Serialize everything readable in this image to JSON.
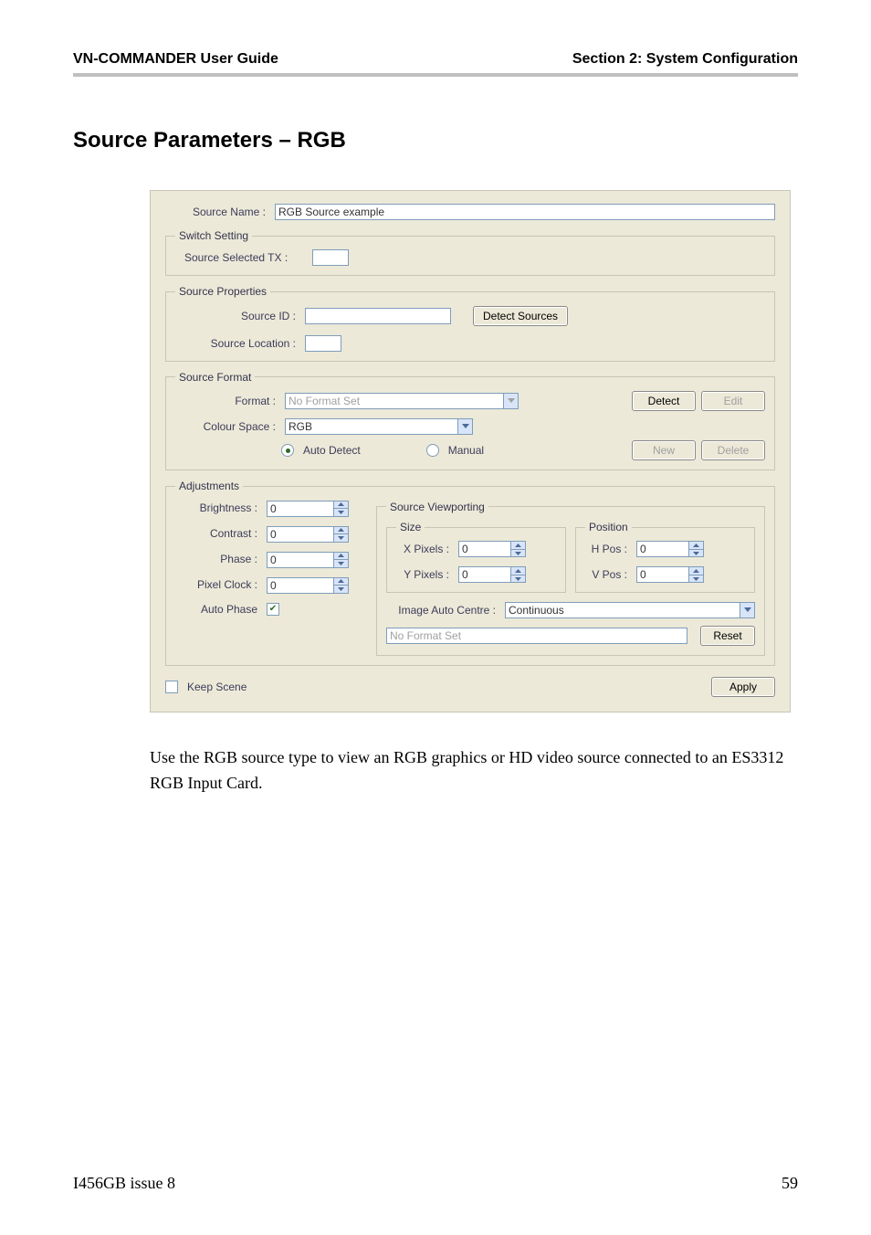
{
  "header": {
    "left": "VN-COMMANDER User Guide",
    "right": "Section 2: System Configuration"
  },
  "heading": "Source Parameters – RGB",
  "source_name": {
    "label": "Source Name :",
    "value": "RGB Source example"
  },
  "switch_setting": {
    "legend": "Switch Setting",
    "tx_label": "Source Selected TX :",
    "tx_value": ""
  },
  "source_properties": {
    "legend": "Source Properties",
    "id_label": "Source ID :",
    "id_value": "",
    "location_label": "Source Location :",
    "location_value": "",
    "detect_btn": "Detect Sources"
  },
  "source_format": {
    "legend": "Source Format",
    "format_label": "Format :",
    "format_value": "No Format Set",
    "colour_label": "Colour Space :",
    "colour_value": "RGB",
    "auto_label": "Auto Detect",
    "manual_label": "Manual",
    "btn_detect": "Detect",
    "btn_edit": "Edit",
    "btn_new": "New",
    "btn_delete": "Delete"
  },
  "adjustments": {
    "legend": "Adjustments",
    "brightness_label": "Brightness :",
    "brightness_value": "0",
    "contrast_label": "Contrast :",
    "contrast_value": "0",
    "phase_label": "Phase :",
    "phase_value": "0",
    "pixel_clock_label": "Pixel Clock :",
    "pixel_clock_value": "0",
    "auto_phase_label": "Auto Phase",
    "viewport_legend": "Source Viewporting",
    "size_legend": "Size",
    "xpixels_label": "X Pixels :",
    "xpixels_value": "0",
    "ypixels_label": "Y Pixels :",
    "ypixels_value": "0",
    "position_legend": "Position",
    "hpos_label": "H Pos :",
    "hpos_value": "0",
    "vpos_label": "V Pos :",
    "vpos_value": "0",
    "image_auto_centre_label": "Image Auto Centre :",
    "image_auto_centre_value": "Continuous",
    "format_text": "No Format Set",
    "reset_btn": "Reset"
  },
  "bottom": {
    "keep_scene_label": "Keep Scene",
    "apply_btn": "Apply"
  },
  "body_text": "Use the RGB source type to view an RGB graphics or HD video source connected to an ES3312 RGB Input Card.",
  "footer": {
    "left": "I456GB issue 8",
    "right": "59"
  }
}
